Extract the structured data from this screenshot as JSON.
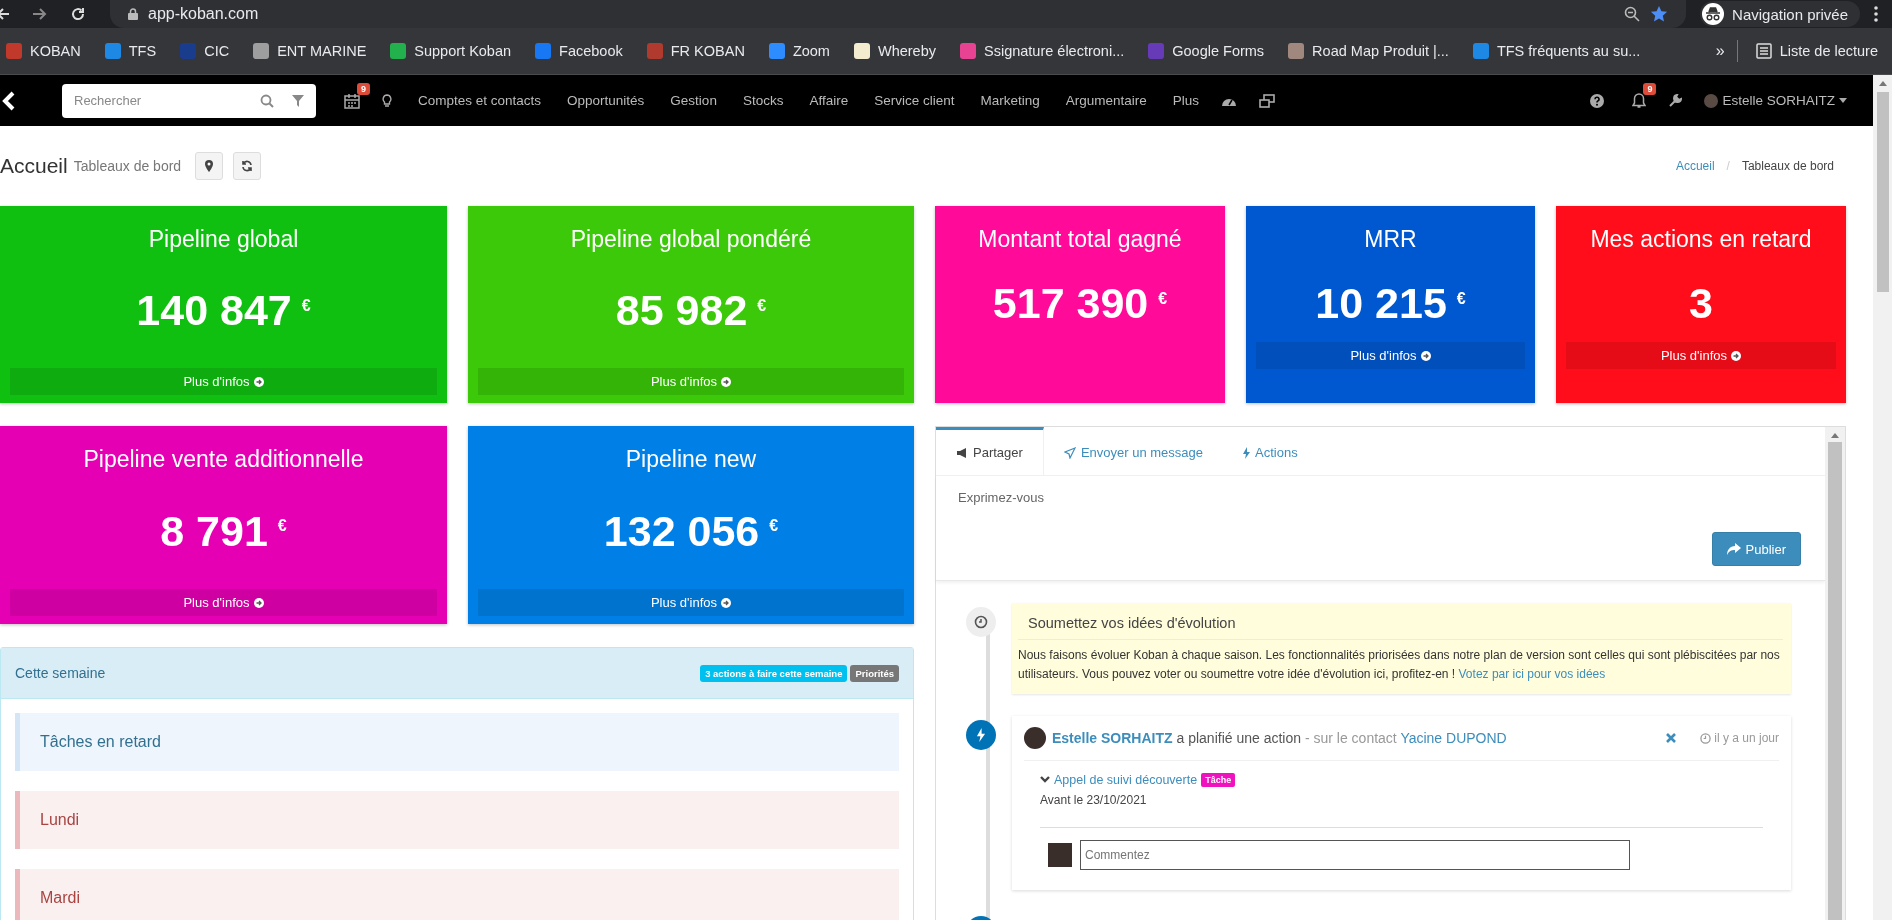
{
  "browser": {
    "url": "app-koban.com",
    "incognito": "Navigation privée",
    "bookmarks": [
      {
        "label": "KOBAN",
        "color": "#c0392b"
      },
      {
        "label": "TFS",
        "color": "#1e88e5"
      },
      {
        "label": "CIC",
        "color": "#1a3c8c"
      },
      {
        "label": "ENT MARINE",
        "color": "#9e9e9e"
      },
      {
        "label": "Support Koban",
        "color": "#22b14c"
      },
      {
        "label": "Facebook",
        "color": "#1877f2"
      },
      {
        "label": "FR KOBAN",
        "color": "#b03a2e"
      },
      {
        "label": "Zoom",
        "color": "#2d8cff"
      },
      {
        "label": "Whereby",
        "color": "#f4eccf"
      },
      {
        "label": "Ssignature électroni...",
        "color": "#e84393"
      },
      {
        "label": "Google Forms",
        "color": "#673ab7"
      },
      {
        "label": "Road Map Produit |...",
        "color": "#a1887f"
      },
      {
        "label": "TFS fréquents au su...",
        "color": "#1e88e5"
      }
    ],
    "more": "»",
    "reading_list": "Liste de lecture"
  },
  "nav": {
    "search_placeholder": "Rechercher",
    "calendar_badge": "9",
    "menu": [
      "Comptes et contacts",
      "Opportunités",
      "Gestion",
      "Stocks",
      "Affaire",
      "Service client",
      "Marketing",
      "Argumentaire",
      "Plus"
    ],
    "bell_badge": "9",
    "user": "Estelle SORHAITZ"
  },
  "header": {
    "title": "Accueil",
    "subtitle": "Tableaux de bord",
    "breadcrumb": [
      "Accueil",
      "Tableaux de bord"
    ],
    "breadcrumb_separator": "/"
  },
  "cards": [
    {
      "title": "Pipeline global",
      "value": "140 847",
      "currency": "€",
      "link": "Plus d'infos",
      "color": "#10c010"
    },
    {
      "title": "Pipeline global pondéré",
      "value": "85 982",
      "currency": "€",
      "link": "Plus d'infos",
      "color": "#3cc90a"
    },
    {
      "title": "Montant total gagné",
      "value": "517 390",
      "currency": "€",
      "color": "#ff0a99"
    },
    {
      "title": "MRR",
      "value": "10 215",
      "currency": "€",
      "link": "Plus d'infos",
      "color": "#0058d0"
    },
    {
      "title": "Mes actions en retard",
      "value": "3",
      "link": "Plus d'infos",
      "color": "#ff0d1a"
    },
    {
      "title": "Pipeline vente additionnelle",
      "value": "8 791",
      "currency": "€",
      "link": "Plus d'infos",
      "color": "#e600b4"
    },
    {
      "title": "Pipeline new",
      "value": "132 056",
      "currency": "€",
      "link": "Plus d'infos",
      "color": "#0080e6"
    }
  ],
  "feed": {
    "tabs": [
      {
        "label": "Partager",
        "selected": true
      },
      {
        "label": "Envoyer un message",
        "selected": false
      },
      {
        "label": "Actions",
        "selected": false
      }
    ],
    "placeholder": "Exprimez-vous",
    "publish": "Publier",
    "notice": {
      "title": "Soumettez vos idées d'évolution",
      "text": "Nous faisons évoluer Koban à chaque saison. Les fonctionnalités priorisées dans notre plan de version sont celles qui sont plébiscitées par nos utilisateurs. Vous pouvez voter ou soumettre votre idée d'évolution ici, profitez-en !",
      "link": "Votez par ici pour vos idées"
    },
    "activity": {
      "author": "Estelle SORHAITZ",
      "action": "a planifié une action",
      "context": "- sur le contact",
      "contact": "Yacine DUPOND",
      "time": "il y a un jour",
      "task": "Appel de suivi découverte",
      "tag": "Tâche",
      "deadline": "Avant le 23/10/2021",
      "comment_placeholder": "Commentez"
    }
  },
  "week": {
    "title": "Cette semaine",
    "badges": [
      {
        "label": "3 actions à faire cette semaine",
        "color": "#00c0ef"
      },
      {
        "label": "Priorités",
        "color": "#777777"
      }
    ],
    "sections": [
      {
        "title": "Tâches en retard",
        "kind": "late"
      },
      {
        "title": "Lundi",
        "kind": "day"
      },
      {
        "title": "Mardi",
        "kind": "day"
      }
    ]
  }
}
